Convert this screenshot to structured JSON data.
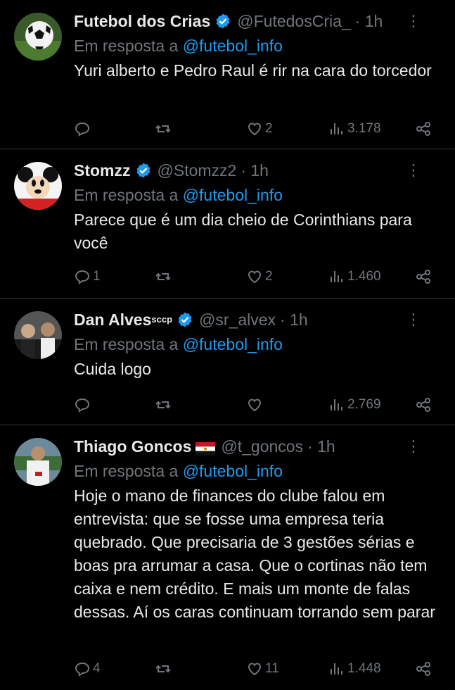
{
  "tweets": [
    {
      "name": "Futebol dos Crias",
      "name_sup": "",
      "handle": "@FutedosCria_",
      "time": "· 1h",
      "reply_prefix": "Em resposta a",
      "reply_to": "@futebol_info",
      "text": "Yuri alberto e Pedro Raul é rir na cara do torcedor",
      "replies": "",
      "retweets": "",
      "likes": "2",
      "views": "3.178"
    },
    {
      "name": "Stomzz",
      "name_sup": "",
      "handle": "@Stomzz2",
      "time": "· 1h",
      "reply_prefix": "Em resposta a",
      "reply_to": "@futebol_info",
      "text": "Parece que é um dia cheio de Corinthians para você",
      "replies": "1",
      "retweets": "",
      "likes": "2",
      "views": "1.460"
    },
    {
      "name": "Dan Alves",
      "name_sup": "sccp",
      "handle": "@sr_alvex",
      "time": "· 1h",
      "reply_prefix": "Em resposta a",
      "reply_to": "@futebol_info",
      "text": "Cuida logo",
      "replies": "",
      "retweets": "",
      "likes": "",
      "views": "2.769"
    },
    {
      "name": "Thiago Goncos",
      "name_sup": "",
      "handle": "@t_goncos",
      "time": "· 1h",
      "reply_prefix": "Em resposta a",
      "reply_to": "@futebol_info",
      "text": "Hoje o mano de finances do clube falou em entrevista: que se fosse uma empresa teria quebrado. Que precisaria de 3 gestões sérias e boas pra arrumar a casa. Que o cortinas não tem caixa e nem crédito. E mais um monte de falas dessas. Aí os caras continuam torrando sem parar",
      "replies": "4",
      "retweets": "",
      "likes": "11",
      "views": "1.448"
    }
  ],
  "icons": {
    "verified": "verified-badge-icon",
    "more": "more-options-icon",
    "reply": "reply-icon",
    "retweet": "retweet-icon",
    "like": "like-icon",
    "views": "views-icon",
    "share": "share-icon",
    "flag": "egypt-flag-icon"
  },
  "colors": {
    "background": "#000000",
    "text": "#e7e9ea",
    "muted": "#71767b",
    "link": "#1d9bf0",
    "divider": "#2f3336"
  }
}
